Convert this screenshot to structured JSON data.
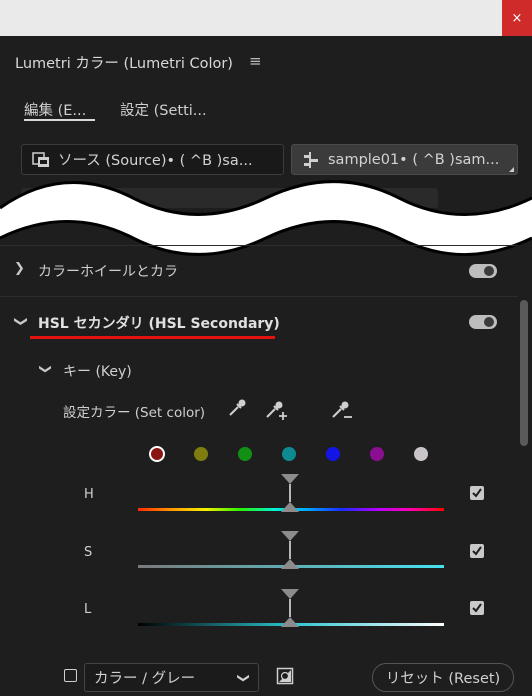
{
  "window": {
    "close_glyph": "×"
  },
  "panel": {
    "title": "Lumetri カラー (Lumetri Color)",
    "menu_icon": "hamburger-menu-icon"
  },
  "tabs": [
    {
      "label": "編集 (E..."
    },
    {
      "label": "設定 (Setti..."
    }
  ],
  "source": {
    "left_label": "ソース (Source)• ( ^B )sa...",
    "right_label": "sample01• ( ^B )sam..."
  },
  "sections": {
    "color_wheels": {
      "label": "カラーホイールとカラ",
      "enabled": true
    },
    "hsl": {
      "label": "HSL セカンダリ (HSL Secondary)",
      "enabled": true
    }
  },
  "key": {
    "label": "キー (Key)",
    "set_color_label": "設定カラー (Set color)",
    "swatches": [
      "#8b1414",
      "#7f7c10",
      "#129015",
      "#0e8a93",
      "#1414e6",
      "#8a0e91",
      "#c8c4c8"
    ],
    "selected_swatch": 0,
    "channels": [
      {
        "label": "H",
        "checked": true
      },
      {
        "label": "S",
        "checked": true
      },
      {
        "label": "L",
        "checked": true
      }
    ]
  },
  "footer": {
    "dropdown_value": "カラー / グレー",
    "reset_label": "リセット (Reset)"
  },
  "colors": {
    "highlight_underline": "#e2130f",
    "background": "#1e1e1e"
  }
}
